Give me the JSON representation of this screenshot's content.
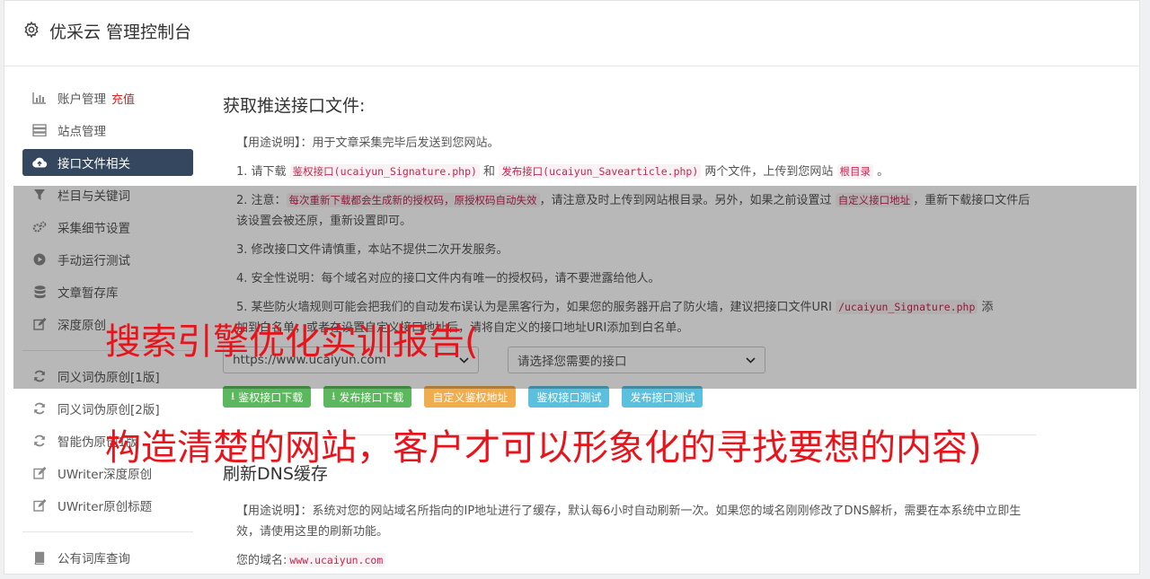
{
  "header": {
    "title": "优采云 管理控制台"
  },
  "sidebar": {
    "items": [
      {
        "label": "账户管理",
        "badge": "充值",
        "icon": "bar-chart-icon"
      },
      {
        "label": "站点管理",
        "icon": "server-icon"
      },
      {
        "label": "接口文件相关",
        "icon": "cloud-upload-icon",
        "active": true
      },
      {
        "label": "栏目与关键词",
        "icon": "filter-icon"
      },
      {
        "label": "采集细节设置",
        "icon": "cogs-icon"
      },
      {
        "label": "手动运行测试",
        "icon": "play-circle-icon"
      },
      {
        "label": "文章暂存库",
        "icon": "database-icon"
      },
      {
        "label": "深度原创",
        "icon": "edit-icon"
      },
      {
        "label": "同义词伪原创[1版]",
        "icon": "refresh-icon"
      },
      {
        "label": "同义词伪原创[2版]",
        "icon": "refresh-icon"
      },
      {
        "label": "智能伪原创1版",
        "icon": "refresh-icon"
      },
      {
        "label": "UWriter深度原创",
        "icon": "edit-icon"
      },
      {
        "label": "UWriter原创标题",
        "icon": "edit-icon"
      },
      {
        "label": "公有词库查询",
        "icon": "book-icon"
      }
    ]
  },
  "main": {
    "section1_title": "获取推送接口文件:",
    "usage1": "【用途说明】：用于文章采集完毕后发送到您网站。",
    "item1": {
      "a": "1. 请下载 ",
      "code1": "鉴权接口(ucaiyun_Signature.php)",
      "b": " 和 ",
      "code2": "发布接口(ucaiyun_Savearticle.php)",
      "c": " 两个文件，上传到您网站 ",
      "code3": "根目录",
      "d": " 。"
    },
    "item2": {
      "a": "2. 注意：",
      "code1": "每次重新下载都会生成新的授权码，原授权码自动失效",
      "b": "，请注意及时上传到网站根目录。另外，如果之前设置过 ",
      "code2": "自定义接口地址",
      "c": "，重新下载接口文件后该设置会被还原，重新设置即可。"
    },
    "item3": "3. 修改接口文件请慎重，本站不提供二次开发服务。",
    "item4": "4. 安全性说明：每个域名对应的接口文件内有唯一的授权码，请不要泄露给他人。",
    "item5": {
      "a": "5. 某些防火墙规则可能会把我们的自动发布误认为是黑客行为，如果您的服务器开启了防火墙，建议把接口文件URI ",
      "code1": "/ucaiyun_Signature.php",
      "b": " 添",
      "c": "加到白名单，或者在设置自定义接口地址后，请将自定义的接口地址URI添加到白名单。"
    },
    "select_site": "https://www.ucaiyun.com",
    "select_api": "请选择您需要的接口",
    "buttons": {
      "download_auth": "鉴权接口下载",
      "download_publish": "发布接口下载",
      "custom_auth": "自定义鉴权地址",
      "test_auth": "鉴权接口测试",
      "test_publish": "发布接口测试"
    },
    "section2_title": "刷新DNS缓存",
    "usage2": "【用途说明】：系统对您的网站域名所指向的IP地址进行了缓存，默认每6小时自动刷新一次。如果您的域名刚刚修改了DNS解析，需要在本系统中立即生效，请使用这里的刷新功能。",
    "domain_label": "您的域名:",
    "domain_value": "www.ucaiyun.com"
  },
  "overlay": {
    "line1": "搜索引擎优化实训报告(",
    "line2": "构造清楚的网站，客户才可以形象化的寻找要想的内容)"
  },
  "colors": {
    "active_nav": "#34475f",
    "green": "#5cb85c",
    "orange": "#f0ad4e",
    "blue": "#5bc0de",
    "overlay_text": "#e8141c"
  }
}
